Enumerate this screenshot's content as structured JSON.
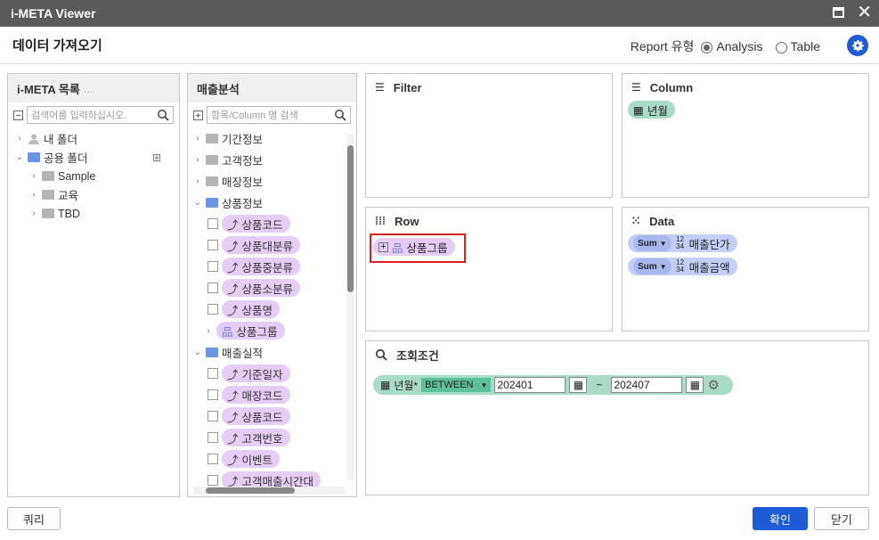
{
  "window": {
    "title": "i-META Viewer"
  },
  "header": {
    "title": "데이터 가져오기",
    "report_type_label": "Report 유형",
    "options": [
      {
        "label": "Analysis",
        "selected": true
      },
      {
        "label": "Table",
        "selected": false
      }
    ]
  },
  "left_panel": {
    "title": "i-META 목록",
    "search_placeholder": "검색어를 입력하십시오.",
    "items": [
      {
        "label": "내 폴더",
        "icon": "person-icon",
        "expanded": false,
        "level": 0
      },
      {
        "label": "공용 폴더",
        "icon": "folder-icon",
        "expanded": true,
        "level": 0
      },
      {
        "label": "Sample",
        "icon": "folder-icon",
        "expanded": false,
        "level": 1
      },
      {
        "label": "교육",
        "icon": "folder-icon",
        "expanded": false,
        "level": 1
      },
      {
        "label": "TBD",
        "icon": "folder-icon",
        "expanded": false,
        "level": 1
      }
    ]
  },
  "middle_panel": {
    "title": "매출분석",
    "search_placeholder": "항목/Column 명 검색",
    "groups": [
      {
        "label": "기간정보"
      },
      {
        "label": "고객정보"
      },
      {
        "label": "매장정보"
      },
      {
        "label": "상품정보"
      },
      {
        "label": "매출실적"
      }
    ],
    "product_items": [
      "상품코드",
      "상품대분류",
      "상품중분류",
      "상품소분류",
      "상품명"
    ],
    "product_group": "상품그룹",
    "sales_items": [
      "기준일자",
      "매장코드",
      "상품코드",
      "고객번호",
      "이벤트",
      "고객매출시간대"
    ]
  },
  "filter": {
    "title": "Filter"
  },
  "column": {
    "title": "Column",
    "items": [
      "년월"
    ]
  },
  "row": {
    "title": "Row",
    "items": [
      "상품그룹"
    ]
  },
  "data": {
    "title": "Data",
    "items": [
      {
        "agg": "Sum",
        "label": "매출단가"
      },
      {
        "agg": "Sum",
        "label": "매출금액"
      }
    ]
  },
  "condition": {
    "title": "조회조건",
    "field": "년월*",
    "operator": "BETWEEN",
    "from": "202401",
    "tilde": "~",
    "to": "202407"
  },
  "footer": {
    "query_label": "쿼리",
    "ok_label": "확인",
    "close_label": "닫기"
  },
  "colors": {
    "accent": "#1e5bd6",
    "pill_purple": "#e6cdf5",
    "pill_green": "#a8dcc6",
    "highlight_red": "#e02020"
  }
}
